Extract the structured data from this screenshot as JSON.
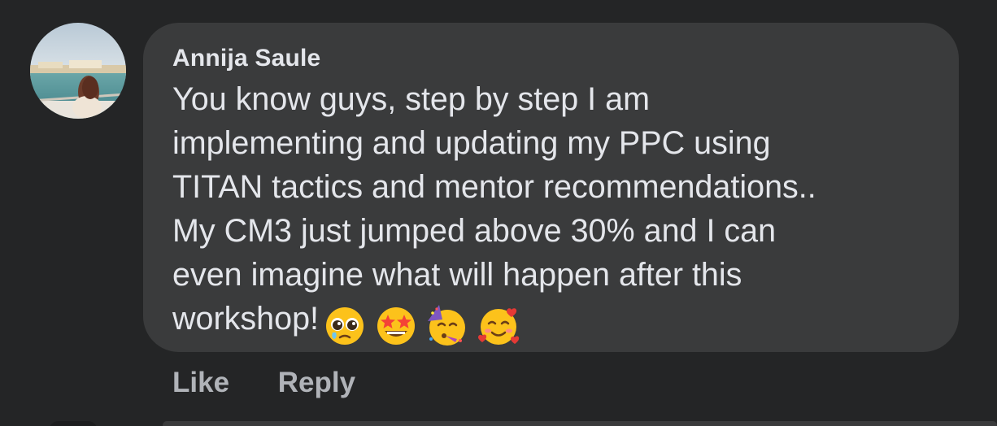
{
  "comment": {
    "author": "Annija Saule",
    "text_lines": [
      "You know guys, step by step I am",
      "implementing and updating my PPC using",
      "TITAN tactics and mentor recommendations..",
      "My CM3 just jumped above 30% and I can",
      "even imagine what will happen after this",
      "workshop!"
    ],
    "emojis": [
      "pleading-face-emoji",
      "star-struck-emoji",
      "partying-face-emoji",
      "smiling-face-with-hearts-emoji"
    ]
  },
  "actions": {
    "like_label": "Like",
    "reply_label": "Reply"
  },
  "colors": {
    "background": "#242526",
    "bubble": "#3a3b3c",
    "text": "#e4e6eb",
    "secondary_text": "#b0b3b8"
  }
}
